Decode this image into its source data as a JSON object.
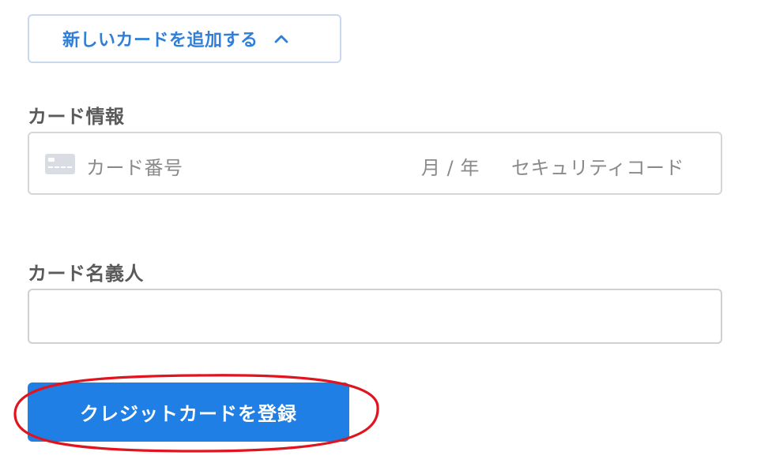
{
  "add_card_toggle": {
    "label": "新しいカードを追加する",
    "icon": "chevron-up-icon",
    "color": "#2f7fd8",
    "border_color": "#c9d8ee"
  },
  "card_info": {
    "label": "カード情報",
    "card_number_placeholder": "カード番号",
    "expiry_placeholder": "月 / 年",
    "cvc_placeholder": "セキュリティコード",
    "icon": "credit-card-icon"
  },
  "card_holder": {
    "label": "カード名義人",
    "value": ""
  },
  "register_button": {
    "label": "クレジットカードを登録",
    "color": "#1f7fe5"
  },
  "annotation": {
    "color": "#e0141e",
    "shape": "ellipse"
  }
}
